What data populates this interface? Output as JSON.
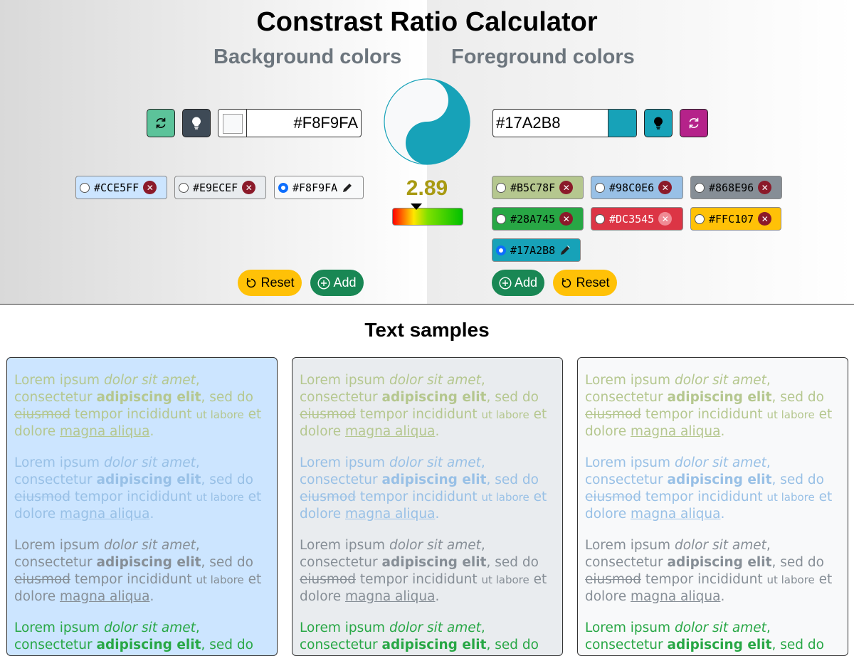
{
  "header": {
    "title": "Constrast Ratio Calculator",
    "background_heading": "Background colors",
    "foreground_heading": "Foreground colors"
  },
  "background": {
    "current_hex": "#F8F9FA",
    "chips": [
      {
        "hex": "#CCE5FF",
        "selected": false,
        "color": "#CCE5FF",
        "text_color": "#000000"
      },
      {
        "hex": "#E9ECEF",
        "selected": false,
        "color": "#E9ECEF",
        "text_color": "#000000"
      },
      {
        "hex": "#F8F9FA",
        "selected": true,
        "color": "#F8F9FA",
        "text_color": "#000000"
      }
    ],
    "reset_label": "Reset",
    "add_label": "Add"
  },
  "foreground": {
    "current_hex": "#17A2B8",
    "chips": [
      {
        "hex": "#B5C78F",
        "selected": false,
        "color": "#B5C78F",
        "text_color": "#000000"
      },
      {
        "hex": "#98C0E6",
        "selected": false,
        "color": "#98C0E6",
        "text_color": "#000000"
      },
      {
        "hex": "#868E96",
        "selected": false,
        "color": "#868E96",
        "text_color": "#000000"
      },
      {
        "hex": "#28A745",
        "selected": false,
        "color": "#28A745",
        "text_color": "#000000"
      },
      {
        "hex": "#DC3545",
        "selected": false,
        "color": "#DC3545",
        "text_color": "#ffffff"
      },
      {
        "hex": "#FFC107",
        "selected": false,
        "color": "#FFC107",
        "text_color": "#000000"
      },
      {
        "hex": "#17A2B8",
        "selected": true,
        "color": "#17A2B8",
        "text_color": "#000000"
      }
    ],
    "add_label": "Add",
    "reset_label": "Reset"
  },
  "contrast": {
    "ratio": "2.89",
    "gauge_level": 0.34
  },
  "samples": {
    "title": "Text samples",
    "text": {
      "w1": "Lorem ipsum",
      "w2": "dolor sit amet",
      "w3": ",",
      "w4": "consectetur",
      "w5": "adipiscing elit",
      "w6": ", sed do",
      "w7": "eiusmod",
      "w8": "tempor incididunt",
      "w9": "ut labore",
      "w10": "et dolore",
      "w11": "magna aliqua",
      "w12": "."
    },
    "panel_backgrounds": [
      "#CCE5FF",
      "#E9ECEF",
      "#F8F9FA"
    ],
    "text_colors": [
      "#B5C78F",
      "#98C0E6",
      "#868E96",
      "#28A745"
    ]
  },
  "colors": {
    "reset_button": "#FFC107",
    "add_button": "#198754",
    "bg_random_button": "#5CC39A",
    "bg_bulb_button": "#3E4A56",
    "fg_bulb_button": "#17A2B8",
    "fg_random_button": "#B5228A",
    "ratio_text": "#A89A12"
  },
  "icons": {
    "random": "refresh-icon",
    "bulb": "lightbulb-icon",
    "edit": "pencil-icon",
    "remove": "close-circle-icon",
    "reset": "undo-icon",
    "add": "plus-circle-icon"
  }
}
